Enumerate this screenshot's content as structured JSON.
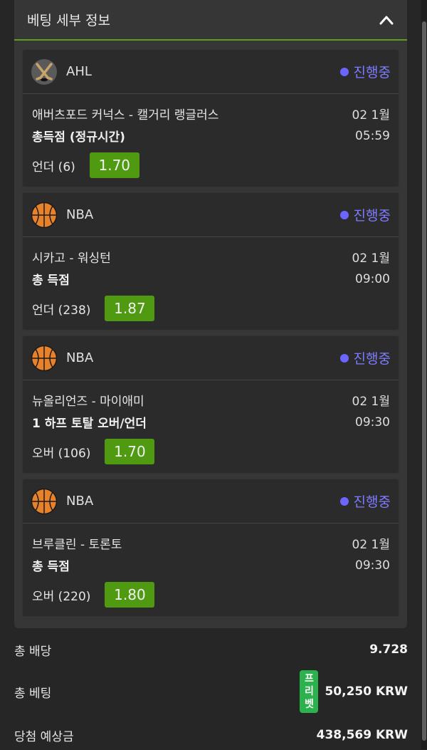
{
  "panel": {
    "title": "베팅 세부 정보"
  },
  "bets": [
    {
      "league": "AHL",
      "league_icon": "hockey-icon",
      "status": "진행중",
      "match": "애버츠포드 커넉스 - 캘거리 랭글러스",
      "date": "02 1월",
      "market": "총득점 (정규시간)",
      "time": "05:59",
      "pick": "언더 (6)",
      "odds": "1.70"
    },
    {
      "league": "NBA",
      "league_icon": "basketball-icon",
      "status": "진행중",
      "match": "시카고 - 워싱턴",
      "date": "02 1월",
      "market": "총 득점",
      "time": "09:00",
      "pick": "언더 (238)",
      "odds": "1.87"
    },
    {
      "league": "NBA",
      "league_icon": "basketball-icon",
      "status": "진행중",
      "match": "뉴올리언즈 - 마이애미",
      "date": "02 1월",
      "market": "1 하프 토탈 오버/언더",
      "time": "09:30",
      "pick": "오버 (106)",
      "odds": "1.70"
    },
    {
      "league": "NBA",
      "league_icon": "basketball-icon",
      "status": "진행중",
      "match": "브루클린 - 토론토",
      "date": "02 1월",
      "market": "총 득점",
      "time": "09:30",
      "pick": "오버 (220)",
      "odds": "1.80"
    }
  ],
  "summary": {
    "total_odds_label": "총 배당",
    "total_odds_value": "9.728",
    "total_stake_label": "총 베팅",
    "freebet_badge": [
      "프",
      "리",
      "벳"
    ],
    "total_stake_value": "50,250 KRW",
    "potential_win_label": "당첨 예상금",
    "potential_win_value": "438,569 KRW"
  },
  "colors": {
    "accent_green": "#4f9a10",
    "status_purple": "#7d7bff",
    "freebet_green": "#2bb24c",
    "basketball_orange": "#e8822a"
  }
}
